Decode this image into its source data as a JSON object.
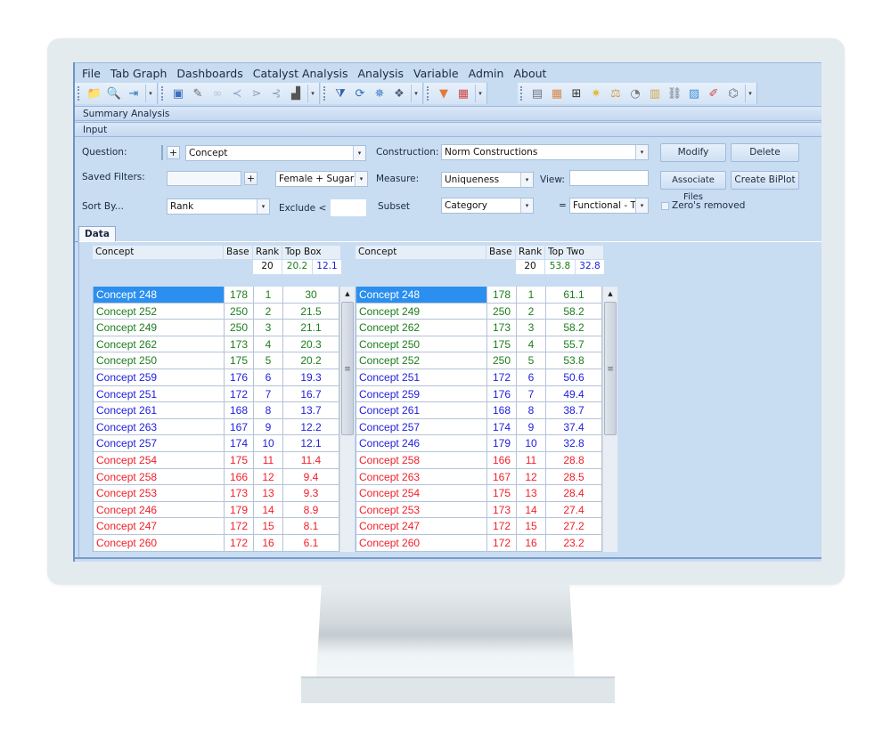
{
  "menu": [
    "File",
    "Tab Graph",
    "Dashboards",
    "Catalyst Analysis",
    "Analysis",
    "Variable",
    "Admin",
    "About"
  ],
  "toolbar": {
    "group1": [
      {
        "name": "open-folder-icon",
        "glyph": "📁",
        "color": "#e3b43a"
      },
      {
        "name": "magnifier-icon",
        "glyph": "🔍",
        "color": "#7a8aa0"
      },
      {
        "name": "import-icon",
        "glyph": "⇥",
        "color": "#2f7ab8"
      }
    ],
    "group2": [
      {
        "name": "chart-frame-icon",
        "glyph": "▣",
        "color": "#3d6fc0"
      },
      {
        "name": "pen-edit-icon",
        "glyph": "✎",
        "color": "#6a6a6a"
      },
      {
        "name": "link-icon",
        "glyph": "∞",
        "color": "#b7c3d0"
      },
      {
        "name": "share-nodes-icon",
        "glyph": "≺",
        "color": "#8ea2c0"
      },
      {
        "name": "tree-nodes-icon",
        "glyph": "⋗",
        "color": "#8ea2c0"
      },
      {
        "name": "branch-icon",
        "glyph": "⊰",
        "color": "#8ea2c0"
      },
      {
        "name": "stamp-icon",
        "glyph": "▟",
        "color": "#555"
      }
    ],
    "group3": [
      {
        "name": "filter-sort-icon",
        "glyph": "⧩",
        "color": "#2f5fa6"
      },
      {
        "name": "refresh-cycle-icon",
        "glyph": "⟳",
        "color": "#2f6fb8"
      },
      {
        "name": "cluster-icon",
        "glyph": "✵",
        "color": "#3a78c0"
      },
      {
        "name": "heart-network-icon",
        "glyph": "❖",
        "color": "#4e5f7a"
      }
    ],
    "group4": [
      {
        "name": "funnel-icon",
        "glyph": "▼",
        "color": "#e07a3a"
      },
      {
        "name": "color-grid-icon",
        "glyph": "▦",
        "color": "#d04848"
      }
    ],
    "group5": [
      {
        "name": "stacked-tables-icon",
        "glyph": "▤",
        "color": "#6d7686"
      },
      {
        "name": "orange-table-icon",
        "glyph": "▦",
        "color": "#d9884a"
      },
      {
        "name": "add-panel-icon",
        "glyph": "⊞",
        "color": "#333"
      },
      {
        "name": "sparkle-icon",
        "glyph": "✷",
        "color": "#e6b82e"
      },
      {
        "name": "balance-scale-icon",
        "glyph": "⚖",
        "color": "#d2a042"
      },
      {
        "name": "gauge-icon",
        "glyph": "◔",
        "color": "#7c7c7c"
      },
      {
        "name": "table-ruler-icon",
        "glyph": "▥",
        "color": "#d6a448"
      },
      {
        "name": "chain-link-icon",
        "glyph": "⛓",
        "color": "#6a7380"
      },
      {
        "name": "map-image-icon",
        "glyph": "▨",
        "color": "#3e8fd0"
      },
      {
        "name": "pencil-note-icon",
        "glyph": "✐",
        "color": "#d04848"
      },
      {
        "name": "hierarchy-icon",
        "glyph": "⌬",
        "color": "#6a7380"
      }
    ]
  },
  "panels": {
    "summary": "Summary Analysis",
    "input": "Input"
  },
  "form": {
    "question_label": "Question:",
    "question_value": "Concept",
    "construction_label": "Construction:",
    "construction_value": "Norm Constructions",
    "saved_filters_label": "Saved Filters:",
    "saved_filters_value": "",
    "filter_combo_value": "Female + Sugar Ac",
    "measure_label": "Measure:",
    "measure_value": "Uniqueness",
    "view_label": "View:",
    "view_value": "",
    "sort_by_label": "Sort By...",
    "sort_by_value": "Rank",
    "exclude_label": "Exclude <",
    "exclude_value": "",
    "subset_label": "Subset",
    "subset_value": "Category",
    "equals_label": "=",
    "subset_match_value": "Functional - T",
    "zeros_label": "Zero's removed",
    "zeros_checked": false,
    "plus": "+",
    "arrow": "▾"
  },
  "buttons": {
    "modify": "Modify",
    "delete": "Delete",
    "associate": "Associate Files",
    "biplot": "Create BiPlot"
  },
  "tabs": {
    "data": "Data"
  },
  "colors": {
    "green": "#1c7d1c",
    "blue": "#2020e0",
    "red": "#f0202a",
    "selected": "#2b8fef"
  },
  "tables": [
    {
      "headers": {
        "concept": "Concept",
        "base": "Base",
        "rank": "Rank",
        "metric": "Top Box"
      },
      "summary": {
        "rank": "20",
        "high": "20.2",
        "low": "12.1"
      },
      "rows": [
        {
          "name": "Concept 248",
          "base": "178",
          "rank": "1",
          "value": "30",
          "tier": "green",
          "selected": true
        },
        {
          "name": "Concept 252",
          "base": "250",
          "rank": "2",
          "value": "21.5",
          "tier": "green"
        },
        {
          "name": "Concept 249",
          "base": "250",
          "rank": "3",
          "value": "21.1",
          "tier": "green"
        },
        {
          "name": "Concept 262",
          "base": "173",
          "rank": "4",
          "value": "20.3",
          "tier": "green"
        },
        {
          "name": "Concept 250",
          "base": "175",
          "rank": "5",
          "value": "20.2",
          "tier": "green"
        },
        {
          "name": "Concept 259",
          "base": "176",
          "rank": "6",
          "value": "19.3",
          "tier": "blue"
        },
        {
          "name": "Concept 251",
          "base": "172",
          "rank": "7",
          "value": "16.7",
          "tier": "blue"
        },
        {
          "name": "Concept 261",
          "base": "168",
          "rank": "8",
          "value": "13.7",
          "tier": "blue"
        },
        {
          "name": "Concept 263",
          "base": "167",
          "rank": "9",
          "value": "12.2",
          "tier": "blue"
        },
        {
          "name": "Concept 257",
          "base": "174",
          "rank": "10",
          "value": "12.1",
          "tier": "blue"
        },
        {
          "name": "Concept 254",
          "base": "175",
          "rank": "11",
          "value": "11.4",
          "tier": "red"
        },
        {
          "name": "Concept 258",
          "base": "166",
          "rank": "12",
          "value": "9.4",
          "tier": "red"
        },
        {
          "name": "Concept 253",
          "base": "173",
          "rank": "13",
          "value": "9.3",
          "tier": "red"
        },
        {
          "name": "Concept 246",
          "base": "179",
          "rank": "14",
          "value": "8.9",
          "tier": "red"
        },
        {
          "name": "Concept 247",
          "base": "172",
          "rank": "15",
          "value": "8.1",
          "tier": "red"
        },
        {
          "name": "Concept 260",
          "base": "172",
          "rank": "16",
          "value": "6.1",
          "tier": "red"
        }
      ]
    },
    {
      "headers": {
        "concept": "Concept",
        "base": "Base",
        "rank": "Rank",
        "metric": "Top Two Box"
      },
      "summary": {
        "rank": "20",
        "high": "53.8",
        "low": "32.8"
      },
      "rows": [
        {
          "name": "Concept 248",
          "base": "178",
          "rank": "1",
          "value": "61.1",
          "tier": "green",
          "selected": true
        },
        {
          "name": "Concept 249",
          "base": "250",
          "rank": "2",
          "value": "58.2",
          "tier": "green"
        },
        {
          "name": "Concept 262",
          "base": "173",
          "rank": "3",
          "value": "58.2",
          "tier": "green"
        },
        {
          "name": "Concept 250",
          "base": "175",
          "rank": "4",
          "value": "55.7",
          "tier": "green"
        },
        {
          "name": "Concept 252",
          "base": "250",
          "rank": "5",
          "value": "53.8",
          "tier": "green"
        },
        {
          "name": "Concept 251",
          "base": "172",
          "rank": "6",
          "value": "50.6",
          "tier": "blue"
        },
        {
          "name": "Concept 259",
          "base": "176",
          "rank": "7",
          "value": "49.4",
          "tier": "blue"
        },
        {
          "name": "Concept 261",
          "base": "168",
          "rank": "8",
          "value": "38.7",
          "tier": "blue"
        },
        {
          "name": "Concept 257",
          "base": "174",
          "rank": "9",
          "value": "37.4",
          "tier": "blue"
        },
        {
          "name": "Concept 246",
          "base": "179",
          "rank": "10",
          "value": "32.8",
          "tier": "blue"
        },
        {
          "name": "Concept 258",
          "base": "166",
          "rank": "11",
          "value": "28.8",
          "tier": "red"
        },
        {
          "name": "Concept 263",
          "base": "167",
          "rank": "12",
          "value": "28.5",
          "tier": "red"
        },
        {
          "name": "Concept 254",
          "base": "175",
          "rank": "13",
          "value": "28.4",
          "tier": "red"
        },
        {
          "name": "Concept 253",
          "base": "173",
          "rank": "14",
          "value": "27.4",
          "tier": "red"
        },
        {
          "name": "Concept 247",
          "base": "172",
          "rank": "15",
          "value": "27.2",
          "tier": "red"
        },
        {
          "name": "Concept 260",
          "base": "172",
          "rank": "16",
          "value": "23.2",
          "tier": "red"
        }
      ]
    }
  ],
  "scroll": {
    "up": "▲",
    "grip": "≡"
  }
}
